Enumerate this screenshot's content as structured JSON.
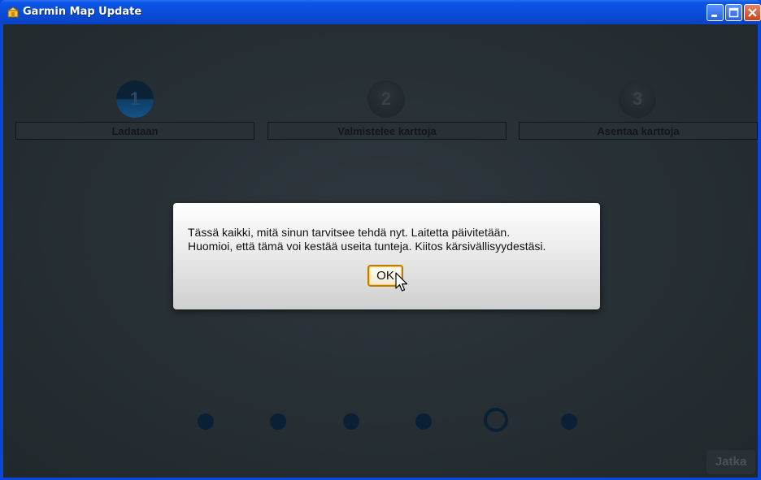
{
  "window": {
    "title": "Garmin Map Update",
    "icon": "garmin-app-icon",
    "controls": [
      "minimize-icon",
      "maximize-icon",
      "close-icon"
    ]
  },
  "steps": [
    {
      "number": "1",
      "label": "Ladataan",
      "state": "active"
    },
    {
      "number": "2",
      "label": "Valmistelee karttoja",
      "state": "inactive"
    },
    {
      "number": "3",
      "label": "Asentaa karttoja",
      "state": "inactive"
    }
  ],
  "dialog": {
    "line1": "Tässä kaikki, mitä sinun tarvitsee tehdä nyt. Laitetta päivitetään.",
    "line2": "Huomioi, että tämä voi kestää useita tunteja. Kiitos kärsivällisyydestäsi.",
    "ok_label": "OK"
  },
  "pager": {
    "total": 6,
    "current": 5
  },
  "next_button": {
    "label": "Jatka",
    "enabled": false
  },
  "colors": {
    "titlebar": "#0a4cd8",
    "background": "#283136",
    "active_step": "#135286",
    "dot": "#0a2135"
  }
}
